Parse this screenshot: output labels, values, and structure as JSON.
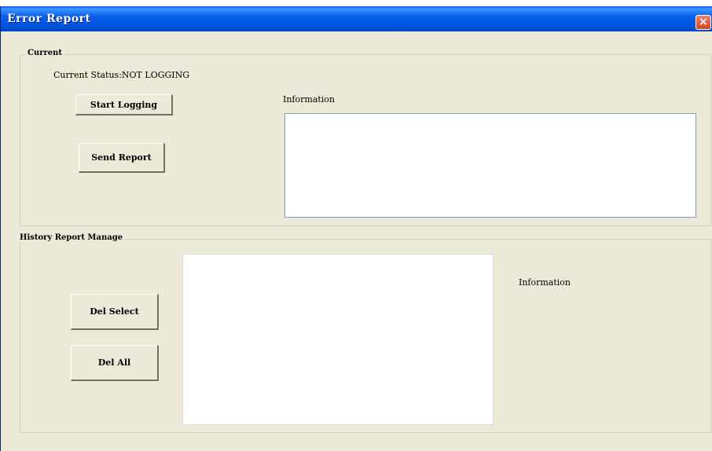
{
  "window": {
    "title": "Error Report",
    "close_label": "×"
  },
  "current_group": {
    "legend": "Current",
    "status_label": "Current Status:",
    "status_value": "NOT LOGGING",
    "start_button": "Start Logging",
    "send_button": "Send Report",
    "info_label": "Information",
    "info_text": ""
  },
  "history_group": {
    "legend": "History Report Manage",
    "del_select_button": "Del Select",
    "del_all_button": "Del All",
    "info_label": "Information",
    "report_list": []
  }
}
